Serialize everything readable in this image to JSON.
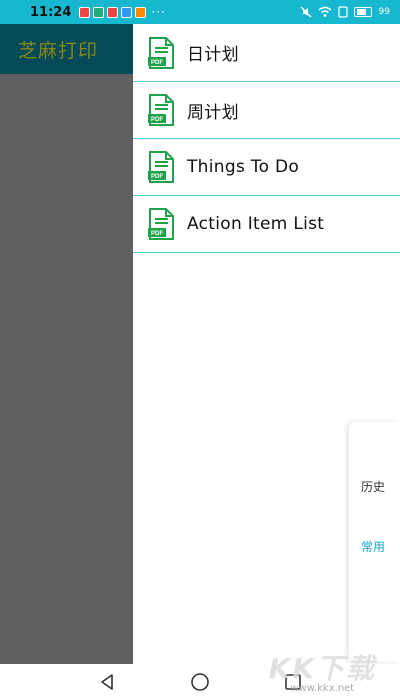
{
  "status_bar": {
    "time": "11:24",
    "more": "···",
    "battery": "99"
  },
  "app": {
    "title": "芝麻打印"
  },
  "drawer": {
    "items": [
      {
        "label": "日计划",
        "icon": "pdf-file-icon"
      },
      {
        "label": "周计划",
        "icon": "pdf-file-icon"
      },
      {
        "label": "Things To Do",
        "icon": "pdf-file-icon"
      },
      {
        "label": "Action Item List",
        "icon": "pdf-file-icon"
      }
    ]
  },
  "side_tabs": {
    "history": "历史",
    "common": "常用"
  },
  "colors": {
    "status_bar": "#16b7cf",
    "header": "#064b57",
    "title_text": "#86861a",
    "panel": "#606060",
    "divider": "#5fc9d6",
    "accent": "#16a6c5",
    "pdf_green": "#1fa24a"
  },
  "watermark": {
    "logo": "KK下载",
    "url": "www.kkx.net"
  }
}
